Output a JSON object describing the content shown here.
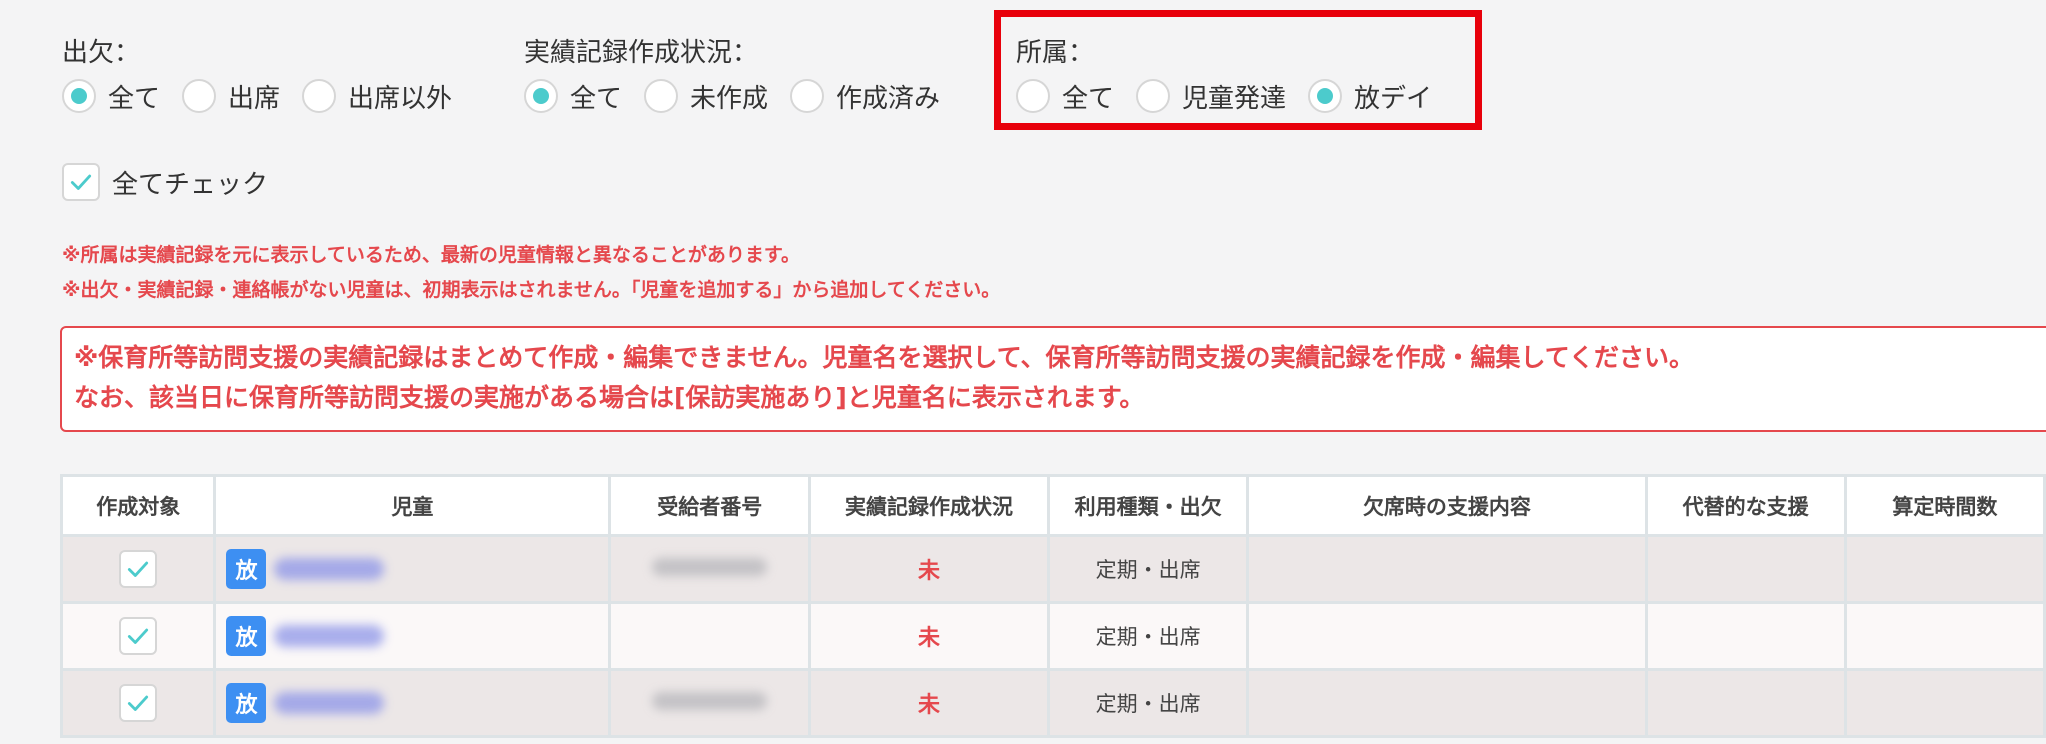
{
  "filters": {
    "attendance": {
      "title": "出欠：",
      "options": [
        {
          "label": "全て",
          "selected": true
        },
        {
          "label": "出席",
          "selected": false
        },
        {
          "label": "出席以外",
          "selected": false
        }
      ]
    },
    "record_status": {
      "title": "実績記録作成状況：",
      "options": [
        {
          "label": "全て",
          "selected": true
        },
        {
          "label": "未作成",
          "selected": false
        },
        {
          "label": "作成済み",
          "selected": false
        }
      ]
    },
    "affiliation": {
      "title": "所属：",
      "options": [
        {
          "label": "全て",
          "selected": false
        },
        {
          "label": "児童発達",
          "selected": false
        },
        {
          "label": "放デイ",
          "selected": true
        }
      ]
    }
  },
  "check_all": {
    "label": "全てチェック",
    "checked": true
  },
  "notes": [
    "※所属は実績記録を元に表示しているため、最新の児童情報と異なることがあります。",
    "※出欠・実績記録・連絡帳がない児童は、初期表示はされません。「児童を追加する」から追加してください。"
  ],
  "notice": {
    "line1": "※保育所等訪問支援の実績記録はまとめて作成・編集できません。児童名を選択して、保育所等訪問支援の実績記録を作成・編集してください。",
    "line2": "なお、該当日に保育所等訪問支援の実施がある場合は[保訪実施あり]と児童名に表示されます。"
  },
  "table": {
    "headers": [
      "作成対象",
      "児童",
      "受給者番号",
      "実績記録作成状況",
      "利用種類・出欠",
      "欠席時の支援内容",
      "代替的な支援",
      "算定時間数"
    ],
    "rows": [
      {
        "checked": true,
        "badge": "放",
        "status": "未",
        "usage": "定期・出席"
      },
      {
        "checked": true,
        "badge": "放",
        "status": "未",
        "usage": "定期・出席"
      },
      {
        "checked": true,
        "badge": "放",
        "status": "未",
        "usage": "定期・出席"
      }
    ]
  },
  "colors": {
    "accent": "#4ccbcc",
    "warning": "#e5484d",
    "highlight": "#e8000b",
    "badge": "#3d8ff2"
  }
}
